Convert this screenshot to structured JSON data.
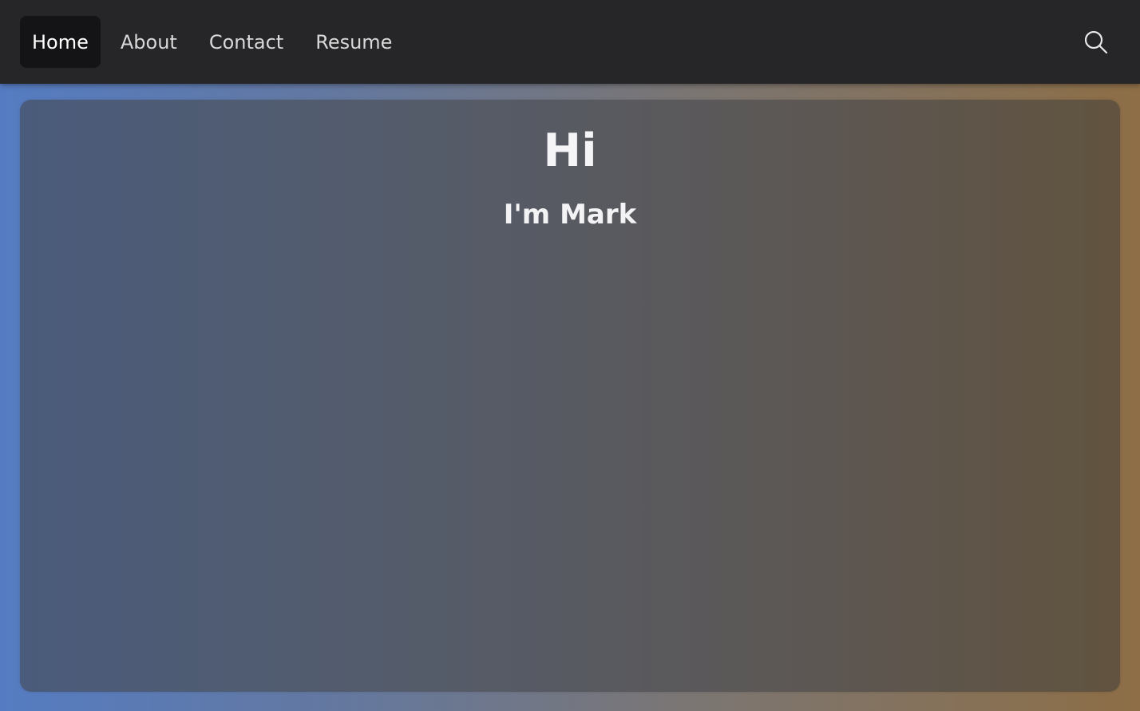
{
  "nav": {
    "items": [
      {
        "label": "Home",
        "active": true
      },
      {
        "label": "About",
        "active": false
      },
      {
        "label": "Contact",
        "active": false
      },
      {
        "label": "Resume",
        "active": false
      }
    ],
    "search_icon": "search-icon"
  },
  "hero": {
    "title": "Hi",
    "subtitle": "I'm Mark"
  },
  "colors": {
    "navbar_bg": "#262628",
    "active_item_bg": "#141416",
    "page_gradient_left": "#557cc2",
    "page_gradient_right": "#8d6e46"
  }
}
